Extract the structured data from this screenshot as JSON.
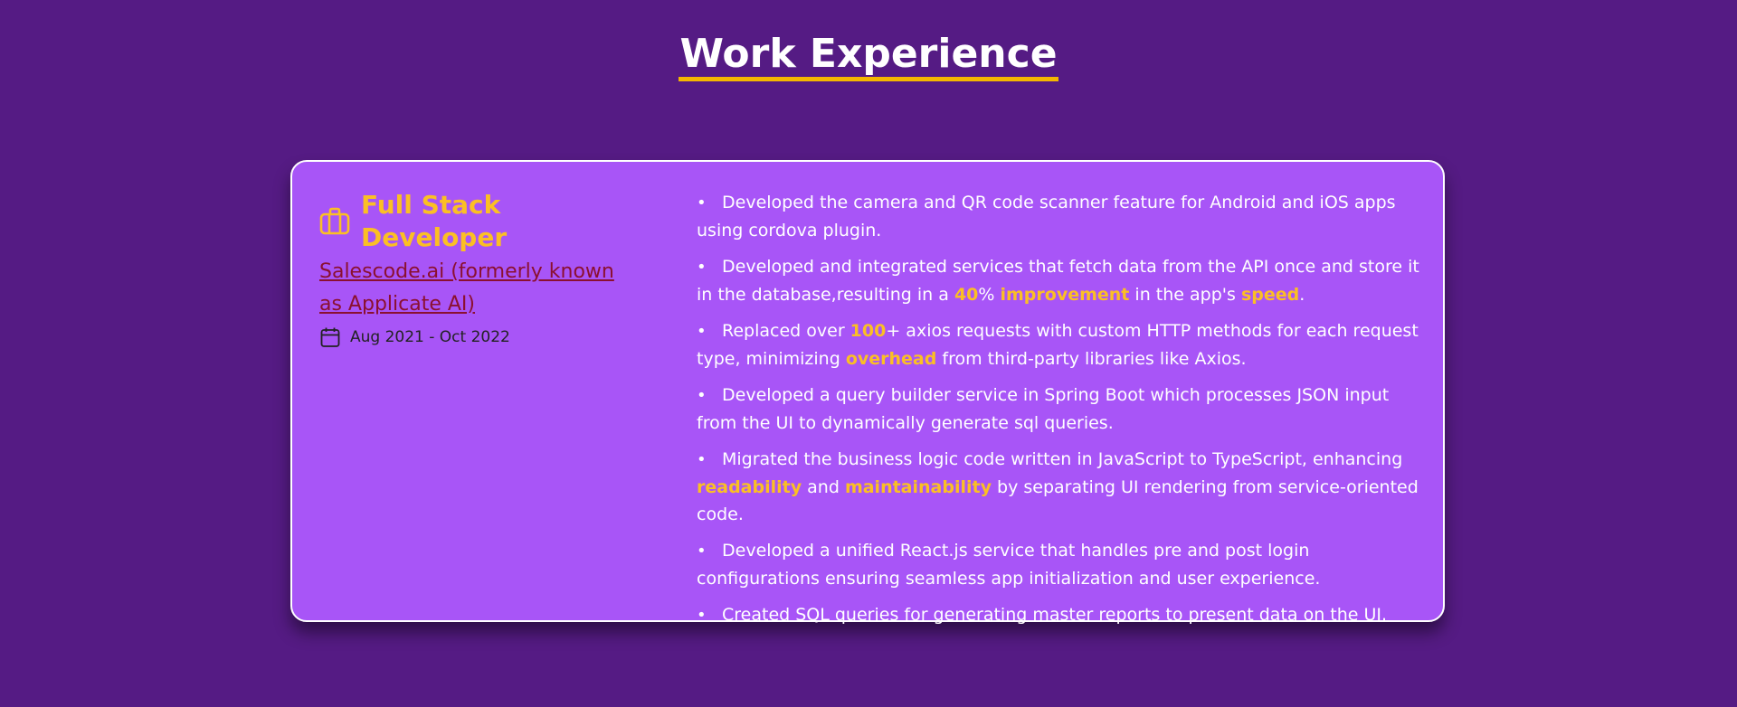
{
  "section": {
    "title": "Work Experience"
  },
  "job": {
    "role_icon": "briefcase-icon",
    "role": "Full Stack Developer",
    "company": "Salescode.ai (formerly known as Applicate AI)",
    "date_icon": "calendar-icon",
    "dates": "Aug 2021 - Oct 2022"
  },
  "bullets": [
    {
      "parts": [
        {
          "text": "Developed the camera and QR code scanner feature for Android and iOS apps using cordova plugin."
        }
      ]
    },
    {
      "parts": [
        {
          "text": "Developed and integrated services that fetch data from the API once and store it in the database,resulting in a "
        },
        {
          "text": "40",
          "hl": true
        },
        {
          "text": "% "
        },
        {
          "text": "improvement",
          "hl": true
        },
        {
          "text": " in the app's "
        },
        {
          "text": "speed",
          "hl": true
        },
        {
          "text": "."
        }
      ]
    },
    {
      "parts": [
        {
          "text": "Replaced over "
        },
        {
          "text": "100",
          "hl": true
        },
        {
          "text": "+ axios requests with custom HTTP methods for each request type, minimizing "
        },
        {
          "text": "overhead",
          "hl": true
        },
        {
          "text": " from third-party libraries like Axios."
        }
      ]
    },
    {
      "parts": [
        {
          "text": "Developed a query builder service in Spring Boot which processes JSON input from the UI to dynamically generate sql queries."
        }
      ]
    },
    {
      "parts": [
        {
          "text": "Migrated the business logic code written in JavaScript to TypeScript, enhancing "
        },
        {
          "text": "readability",
          "hl": true
        },
        {
          "text": " and "
        },
        {
          "text": "maintainability",
          "hl": true
        },
        {
          "text": " by separating UI rendering from service-oriented code."
        }
      ]
    },
    {
      "parts": [
        {
          "text": "Developed a unified React.js service that handles pre and post login configurations ensuring seamless app initialization and user experience."
        }
      ]
    },
    {
      "parts": [
        {
          "text": "Created SQL queries for generating master reports to present data on the UI."
        }
      ]
    }
  ],
  "colors": {
    "background": "#551b84",
    "card": "#a855f7",
    "accent": "#fbbf24",
    "underline": "#f5b700",
    "company_link": "#8b1030"
  }
}
